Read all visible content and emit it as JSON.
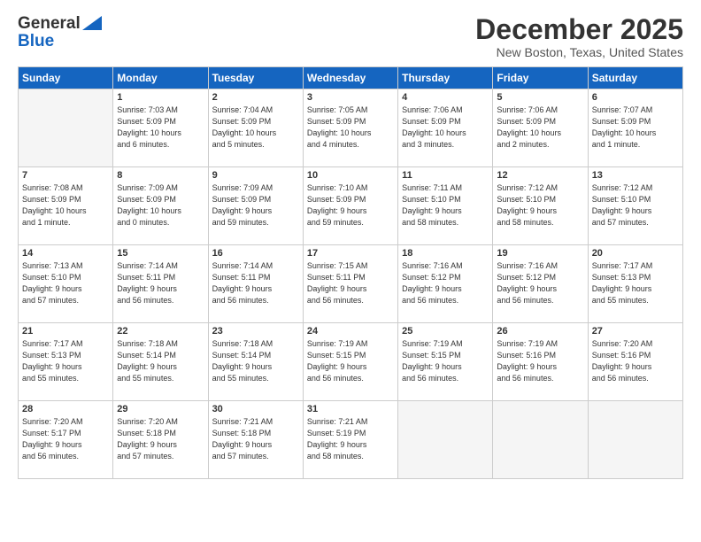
{
  "logo": {
    "line1": "General",
    "line2": "Blue"
  },
  "title": "December 2025",
  "location": "New Boston, Texas, United States",
  "days_header": [
    "Sunday",
    "Monday",
    "Tuesday",
    "Wednesday",
    "Thursday",
    "Friday",
    "Saturday"
  ],
  "weeks": [
    [
      {
        "day": "",
        "info": ""
      },
      {
        "day": "1",
        "info": "Sunrise: 7:03 AM\nSunset: 5:09 PM\nDaylight: 10 hours\nand 6 minutes."
      },
      {
        "day": "2",
        "info": "Sunrise: 7:04 AM\nSunset: 5:09 PM\nDaylight: 10 hours\nand 5 minutes."
      },
      {
        "day": "3",
        "info": "Sunrise: 7:05 AM\nSunset: 5:09 PM\nDaylight: 10 hours\nand 4 minutes."
      },
      {
        "day": "4",
        "info": "Sunrise: 7:06 AM\nSunset: 5:09 PM\nDaylight: 10 hours\nand 3 minutes."
      },
      {
        "day": "5",
        "info": "Sunrise: 7:06 AM\nSunset: 5:09 PM\nDaylight: 10 hours\nand 2 minutes."
      },
      {
        "day": "6",
        "info": "Sunrise: 7:07 AM\nSunset: 5:09 PM\nDaylight: 10 hours\nand 1 minute."
      }
    ],
    [
      {
        "day": "7",
        "info": "Sunrise: 7:08 AM\nSunset: 5:09 PM\nDaylight: 10 hours\nand 1 minute."
      },
      {
        "day": "8",
        "info": "Sunrise: 7:09 AM\nSunset: 5:09 PM\nDaylight: 10 hours\nand 0 minutes."
      },
      {
        "day": "9",
        "info": "Sunrise: 7:09 AM\nSunset: 5:09 PM\nDaylight: 9 hours\nand 59 minutes."
      },
      {
        "day": "10",
        "info": "Sunrise: 7:10 AM\nSunset: 5:09 PM\nDaylight: 9 hours\nand 59 minutes."
      },
      {
        "day": "11",
        "info": "Sunrise: 7:11 AM\nSunset: 5:10 PM\nDaylight: 9 hours\nand 58 minutes."
      },
      {
        "day": "12",
        "info": "Sunrise: 7:12 AM\nSunset: 5:10 PM\nDaylight: 9 hours\nand 58 minutes."
      },
      {
        "day": "13",
        "info": "Sunrise: 7:12 AM\nSunset: 5:10 PM\nDaylight: 9 hours\nand 57 minutes."
      }
    ],
    [
      {
        "day": "14",
        "info": "Sunrise: 7:13 AM\nSunset: 5:10 PM\nDaylight: 9 hours\nand 57 minutes."
      },
      {
        "day": "15",
        "info": "Sunrise: 7:14 AM\nSunset: 5:11 PM\nDaylight: 9 hours\nand 56 minutes."
      },
      {
        "day": "16",
        "info": "Sunrise: 7:14 AM\nSunset: 5:11 PM\nDaylight: 9 hours\nand 56 minutes."
      },
      {
        "day": "17",
        "info": "Sunrise: 7:15 AM\nSunset: 5:11 PM\nDaylight: 9 hours\nand 56 minutes."
      },
      {
        "day": "18",
        "info": "Sunrise: 7:16 AM\nSunset: 5:12 PM\nDaylight: 9 hours\nand 56 minutes."
      },
      {
        "day": "19",
        "info": "Sunrise: 7:16 AM\nSunset: 5:12 PM\nDaylight: 9 hours\nand 56 minutes."
      },
      {
        "day": "20",
        "info": "Sunrise: 7:17 AM\nSunset: 5:13 PM\nDaylight: 9 hours\nand 55 minutes."
      }
    ],
    [
      {
        "day": "21",
        "info": "Sunrise: 7:17 AM\nSunset: 5:13 PM\nDaylight: 9 hours\nand 55 minutes."
      },
      {
        "day": "22",
        "info": "Sunrise: 7:18 AM\nSunset: 5:14 PM\nDaylight: 9 hours\nand 55 minutes."
      },
      {
        "day": "23",
        "info": "Sunrise: 7:18 AM\nSunset: 5:14 PM\nDaylight: 9 hours\nand 55 minutes."
      },
      {
        "day": "24",
        "info": "Sunrise: 7:19 AM\nSunset: 5:15 PM\nDaylight: 9 hours\nand 56 minutes."
      },
      {
        "day": "25",
        "info": "Sunrise: 7:19 AM\nSunset: 5:15 PM\nDaylight: 9 hours\nand 56 minutes."
      },
      {
        "day": "26",
        "info": "Sunrise: 7:19 AM\nSunset: 5:16 PM\nDaylight: 9 hours\nand 56 minutes."
      },
      {
        "day": "27",
        "info": "Sunrise: 7:20 AM\nSunset: 5:16 PM\nDaylight: 9 hours\nand 56 minutes."
      }
    ],
    [
      {
        "day": "28",
        "info": "Sunrise: 7:20 AM\nSunset: 5:17 PM\nDaylight: 9 hours\nand 56 minutes."
      },
      {
        "day": "29",
        "info": "Sunrise: 7:20 AM\nSunset: 5:18 PM\nDaylight: 9 hours\nand 57 minutes."
      },
      {
        "day": "30",
        "info": "Sunrise: 7:21 AM\nSunset: 5:18 PM\nDaylight: 9 hours\nand 57 minutes."
      },
      {
        "day": "31",
        "info": "Sunrise: 7:21 AM\nSunset: 5:19 PM\nDaylight: 9 hours\nand 58 minutes."
      },
      {
        "day": "",
        "info": ""
      },
      {
        "day": "",
        "info": ""
      },
      {
        "day": "",
        "info": ""
      }
    ]
  ]
}
